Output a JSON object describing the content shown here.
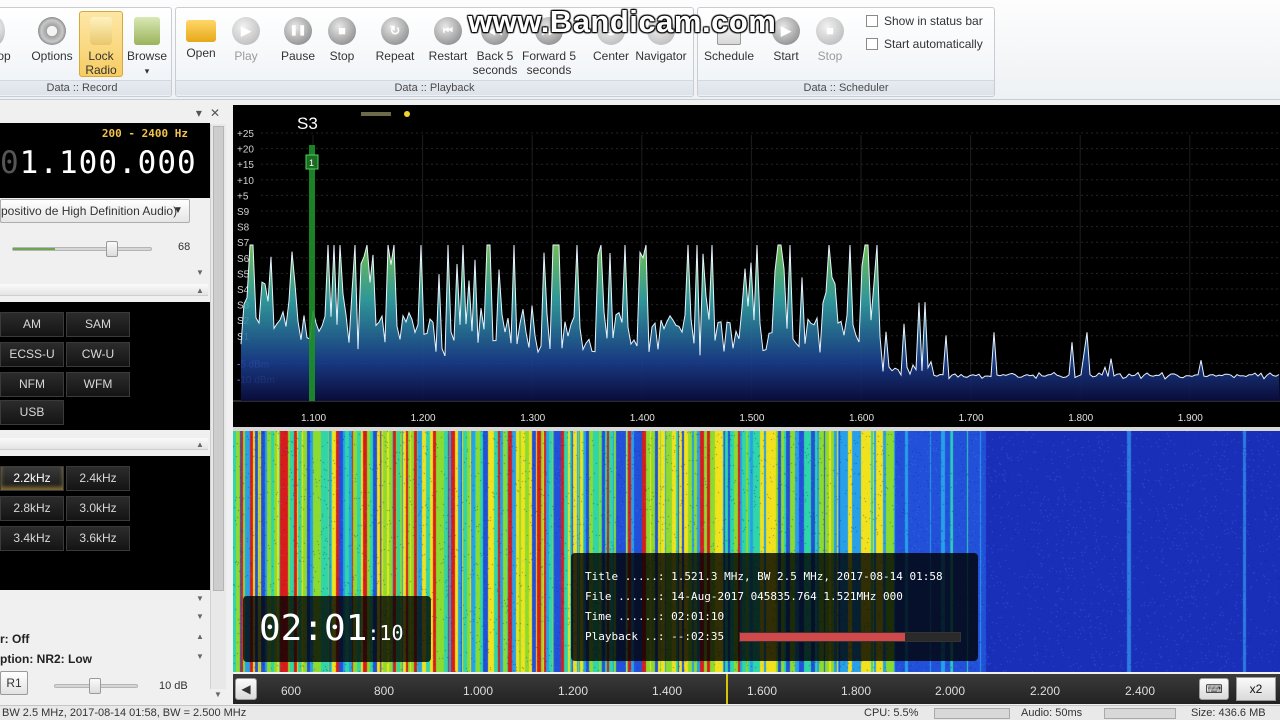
{
  "watermark": "www.Bandicam.com",
  "ribbon": {
    "record": {
      "label": "Data :: Record",
      "buttons": [
        {
          "label": "op"
        },
        {
          "label": "Options",
          "icon": "gear-icon"
        },
        {
          "label": "Lock Radio",
          "icon": "lock-icon"
        },
        {
          "label": "Browse",
          "icon": "browse-icon",
          "sub": "▾"
        }
      ]
    },
    "playback": {
      "label": "Data :: Playback",
      "buttons": [
        {
          "label": "Open",
          "icon": "folder-icon",
          "symbol": ""
        },
        {
          "label": "Play",
          "icon": "play-icon",
          "symbol": "▶"
        },
        {
          "label": "Pause",
          "icon": "pause-icon",
          "symbol": "❚❚"
        },
        {
          "label": "Stop",
          "icon": "stop-icon",
          "symbol": "■"
        },
        {
          "label": "Repeat",
          "icon": "repeat-icon",
          "symbol": "↻"
        },
        {
          "label": "Restart",
          "icon": "restart-icon",
          "symbol": "⏮"
        },
        {
          "label": "Back 5 seconds",
          "icon": "back-icon",
          "symbol": "◀◀"
        },
        {
          "label": "Forward 5 seconds",
          "icon": "forward-icon",
          "symbol": "▶▶"
        },
        {
          "label": "Center",
          "icon": "center-icon",
          "symbol": "⊕"
        },
        {
          "label": "Navigator",
          "icon": "navigator-icon",
          "symbol": "⇔"
        }
      ]
    },
    "scheduler": {
      "label": "Data :: Scheduler",
      "buttons": [
        {
          "label": "Schedule",
          "icon": "calendar-icon",
          "symbol": ""
        },
        {
          "label": "Start",
          "icon": "start-icon",
          "symbol": "▶"
        },
        {
          "label": "Stop",
          "icon": "stop-icon",
          "symbol": "■"
        }
      ],
      "checks": [
        "Show in status bar",
        "Start automatically"
      ]
    }
  },
  "panel": {
    "close": "✕",
    "pin": "▾",
    "freq_range": "200 - 2400 Hz",
    "freq_ghost": "0",
    "freq_main": "1.100.000",
    "device": "positivo de High Definition Audio)",
    "volume": "68",
    "volume_level": 0.68,
    "modes": [
      "AM",
      "SAM",
      "ECSS-U",
      "CW-U",
      "NFM",
      "WFM",
      "USB"
    ],
    "bandwidths": [
      "2.2kHz",
      "2.4kHz",
      "2.8kHz",
      "3.0kHz",
      "3.4kHz",
      "3.6kHz"
    ],
    "status1": "r: Off",
    "status2": "ption: NR2: Low",
    "nr_button": "R1",
    "db_label": "10 dB"
  },
  "spectrum": {
    "s_label": "S3",
    "marker": "1",
    "db_levels": [
      "+25",
      "+20",
      "+15",
      "+10",
      "+5",
      "S9",
      "S8",
      "S7",
      "S6",
      "S5",
      "S4",
      "S3",
      "S2",
      "S1",
      "-5 dBm",
      "-10 dBm"
    ],
    "freq_ticks": [
      "1.100",
      "1.200",
      "1.300",
      "1.400",
      "1.500",
      "1.600",
      "1.700",
      "1.800",
      "1.900"
    ]
  },
  "waterfall": {
    "timer_main": "02:01",
    "timer_small": ":10",
    "info": [
      "Title .....: 1.521.3 MHz, BW 2.5 MHz, 2017-08-14 01:58",
      "File ......: 14-Aug-2017 045835.764 1.521MHz 000",
      "Time ......: 02:01:10",
      "Playback ..: --:02:35"
    ],
    "playback_progress": 0.75
  },
  "bottom_axis": {
    "ticks": [
      "600",
      "800",
      "1.000",
      "1.200",
      "1.400",
      "1.600",
      "1.800",
      "2.000",
      "2.200",
      "2.400"
    ],
    "zoom": "x2",
    "keyboard": "⌨"
  },
  "statusbar": {
    "left": "BW 2.5 MHz, 2017-08-14 01:58, BW = 2.500 MHz",
    "cpu": "CPU: 5.5%",
    "audio": "Audio: 50ms",
    "size": "Size: 436.6 MB"
  },
  "colors": {
    "accent": "#f7cd63",
    "spectrum_fill": "#2f8fb0",
    "waterfall_bg": "#1a2fb8",
    "progress": "#d0484a"
  }
}
